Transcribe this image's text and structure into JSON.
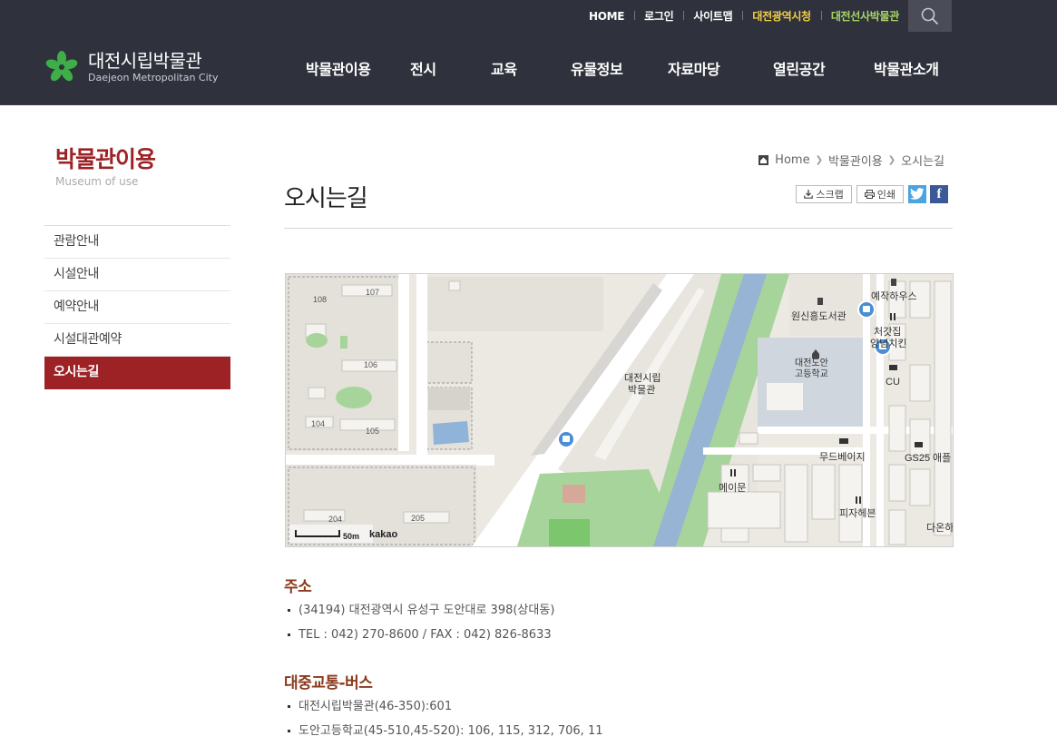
{
  "util_nav": [
    {
      "label": "HOME"
    },
    {
      "label": "로그인"
    },
    {
      "label": "사이트맵"
    },
    {
      "label": "대전광역시청"
    },
    {
      "label": "대전선사박물관"
    }
  ],
  "logo": {
    "ko": "대전시립박물관",
    "en": "Daejeon Metropolitan City"
  },
  "gnb": [
    {
      "label": "박물관이용"
    },
    {
      "label": "전시"
    },
    {
      "label": "교육"
    },
    {
      "label": "유물정보"
    },
    {
      "label": "자료마당"
    },
    {
      "label": "열린공간"
    },
    {
      "label": "박물관소개"
    }
  ],
  "lnb": {
    "title": "박물관이용",
    "subtitle": "Museum of use",
    "items": [
      {
        "label": "관람안내"
      },
      {
        "label": "시설안내"
      },
      {
        "label": "예약안내"
      },
      {
        "label": "시설대관예약"
      },
      {
        "label": "오시는길"
      }
    ]
  },
  "breadcrumb": [
    "Home",
    "박물관이용",
    "오시는길"
  ],
  "page": {
    "title": "오시는길"
  },
  "tools": {
    "scrap": "스크랩",
    "print": "인쇄",
    "twitter": "t",
    "facebook": "f"
  },
  "map": {
    "museum_label_1": "대전시립",
    "museum_label_2": "박물관",
    "library": "원신흥도서관",
    "yejak": "예작하우스",
    "cheot_1": "처갓집",
    "cheot_2": "양념치킨",
    "school_1": "대전도안",
    "school_2": "고등학교",
    "cu": "CU",
    "mood": "무드베이지",
    "gs25": "GS25",
    "gs25_extra": "애플",
    "mayi": "메이문",
    "pizza": "피자헤븐",
    "daon": "다온하",
    "apt_107": "107",
    "apt_108": "108",
    "apt_106": "106",
    "apt_104": "104",
    "apt_105": "105",
    "apt_204": "204",
    "apt_205": "205",
    "scale": "50m",
    "brand": "kakao"
  },
  "address": {
    "title": "주소",
    "items": [
      {
        "text": "(34194) 대전광역시 유성구 도안대로 398(상대동)"
      },
      {
        "text": "TEL : 042) 270-8600 / FAX : 042) 826-8633"
      }
    ]
  },
  "bus": {
    "title": "대중교통-버스",
    "items": [
      {
        "text": "대전시립박물관(46-350):601"
      },
      {
        "text": "도안고등학교(45-510,45-520): 106, 115, 312, 706, 11"
      }
    ]
  }
}
